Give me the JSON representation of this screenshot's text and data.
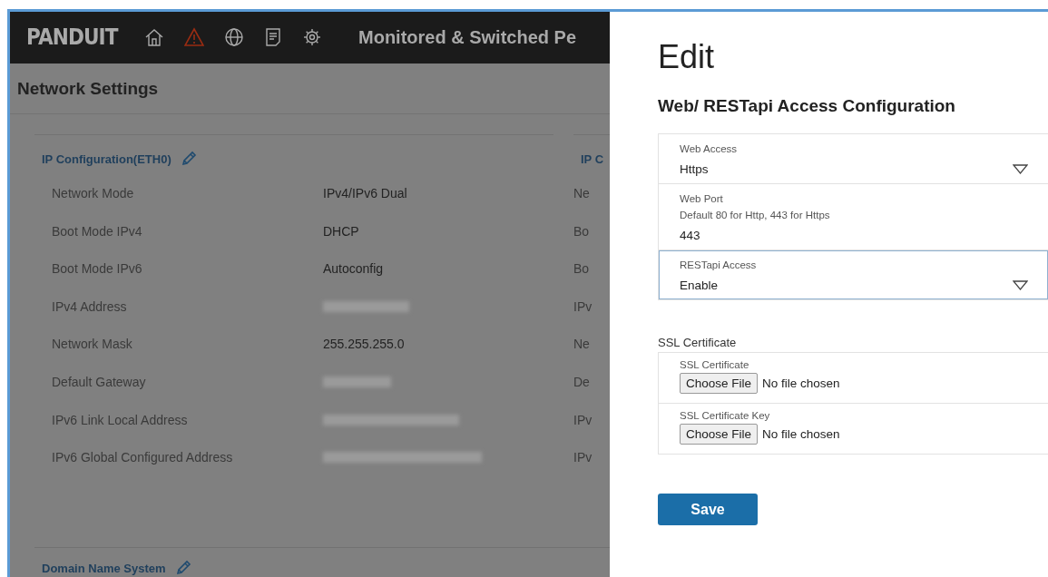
{
  "header": {
    "logo": "PANDUIT",
    "title": "Monitored & Switched Pe",
    "nav_icons": [
      {
        "kind": "home"
      },
      {
        "kind": "warning"
      },
      {
        "kind": "globe"
      },
      {
        "kind": "document"
      },
      {
        "kind": "gear"
      }
    ]
  },
  "page_title": "Network Settings",
  "ip_section": {
    "title": "IP Configuration(ETH0)",
    "rows": [
      {
        "label": "Network Mode",
        "value": "IPv4/IPv6 Dual",
        "redacted": false
      },
      {
        "label": "Boot Mode IPv4",
        "value": "DHCP",
        "redacted": false
      },
      {
        "label": "Boot Mode IPv6",
        "value": "Autoconfig",
        "redacted": false
      },
      {
        "label": "IPv4 Address",
        "redacted": true
      },
      {
        "label": "Network Mask",
        "value": "255.255.255.0",
        "redacted": false
      },
      {
        "label": "Default Gateway",
        "redacted": true
      },
      {
        "label": "IPv6 Link Local Address",
        "redacted": true
      },
      {
        "label": "IPv6 Global Configured Address",
        "redacted": true
      }
    ]
  },
  "ip_section_2": {
    "title": "IP C",
    "rows": [
      "Ne",
      "Bo",
      "Bo",
      "IPv",
      "Ne",
      "De",
      "IPv",
      "IPv"
    ]
  },
  "dns_section": {
    "title": "Domain Name System"
  },
  "edit_panel": {
    "heading": "Edit",
    "subtitle": "Web/ RESTapi Access Configuration",
    "fields": [
      {
        "kind": "select",
        "label": "Web Access",
        "value": "Https",
        "focused": false
      },
      {
        "kind": "text",
        "label": "Web Port",
        "hint": "Default 80 for Http, 443 for Https",
        "value": "443",
        "focused": false
      },
      {
        "kind": "select",
        "label": "RESTapi Access",
        "value": "Enable",
        "focused": true
      }
    ],
    "ssl_title": "SSL Certificate",
    "files": [
      {
        "label": "SSL Certificate",
        "button": "Choose File",
        "status": "No file chosen"
      },
      {
        "label": "SSL Certificate Key",
        "button": "Choose File",
        "status": "No file chosen"
      }
    ],
    "save": "Save"
  }
}
